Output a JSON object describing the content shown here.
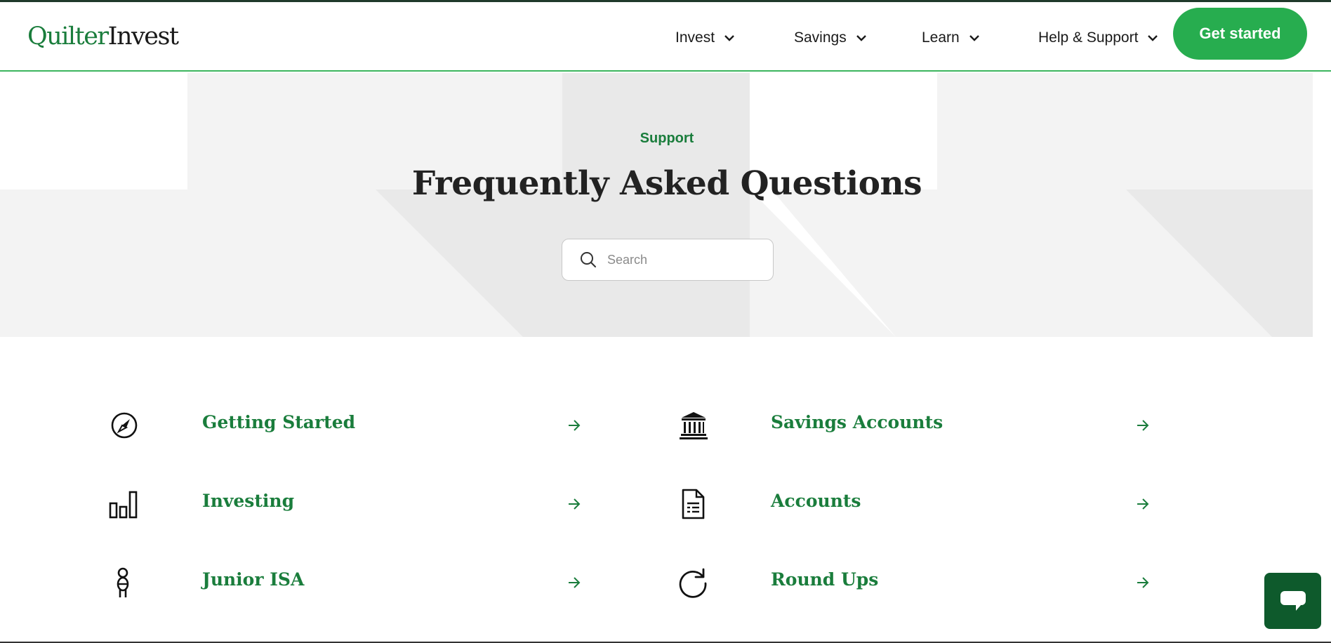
{
  "brand": {
    "logo_part1": "Quilter",
    "logo_part2": "Invest",
    "primary_color": "#1a7d3c",
    "accent_color": "#27ad4f"
  },
  "nav": {
    "items": [
      {
        "label": "Invest",
        "icon": "chevron-down-icon"
      },
      {
        "label": "Savings",
        "icon": "chevron-down-icon"
      },
      {
        "label": "Learn",
        "icon": "chevron-down-icon"
      },
      {
        "label": "Help & Support",
        "icon": "chevron-down-icon"
      }
    ],
    "cta_label": "Get started"
  },
  "hero": {
    "eyebrow": "Support",
    "title": "Frequently Asked Questions",
    "search": {
      "placeholder": "Search",
      "value": "",
      "icon": "search-icon"
    }
  },
  "categories": [
    {
      "label": "Getting Started",
      "icon": "compass-icon"
    },
    {
      "label": "Savings Accounts",
      "icon": "bank-icon"
    },
    {
      "label": "Investing",
      "icon": "bar-chart-icon"
    },
    {
      "label": "Accounts",
      "icon": "document-icon"
    },
    {
      "label": "Junior ISA",
      "icon": "child-icon"
    },
    {
      "label": "Round Ups",
      "icon": "refresh-icon"
    }
  ],
  "chat": {
    "icon": "chat-bubble-icon",
    "color": "#0e5a2c"
  }
}
